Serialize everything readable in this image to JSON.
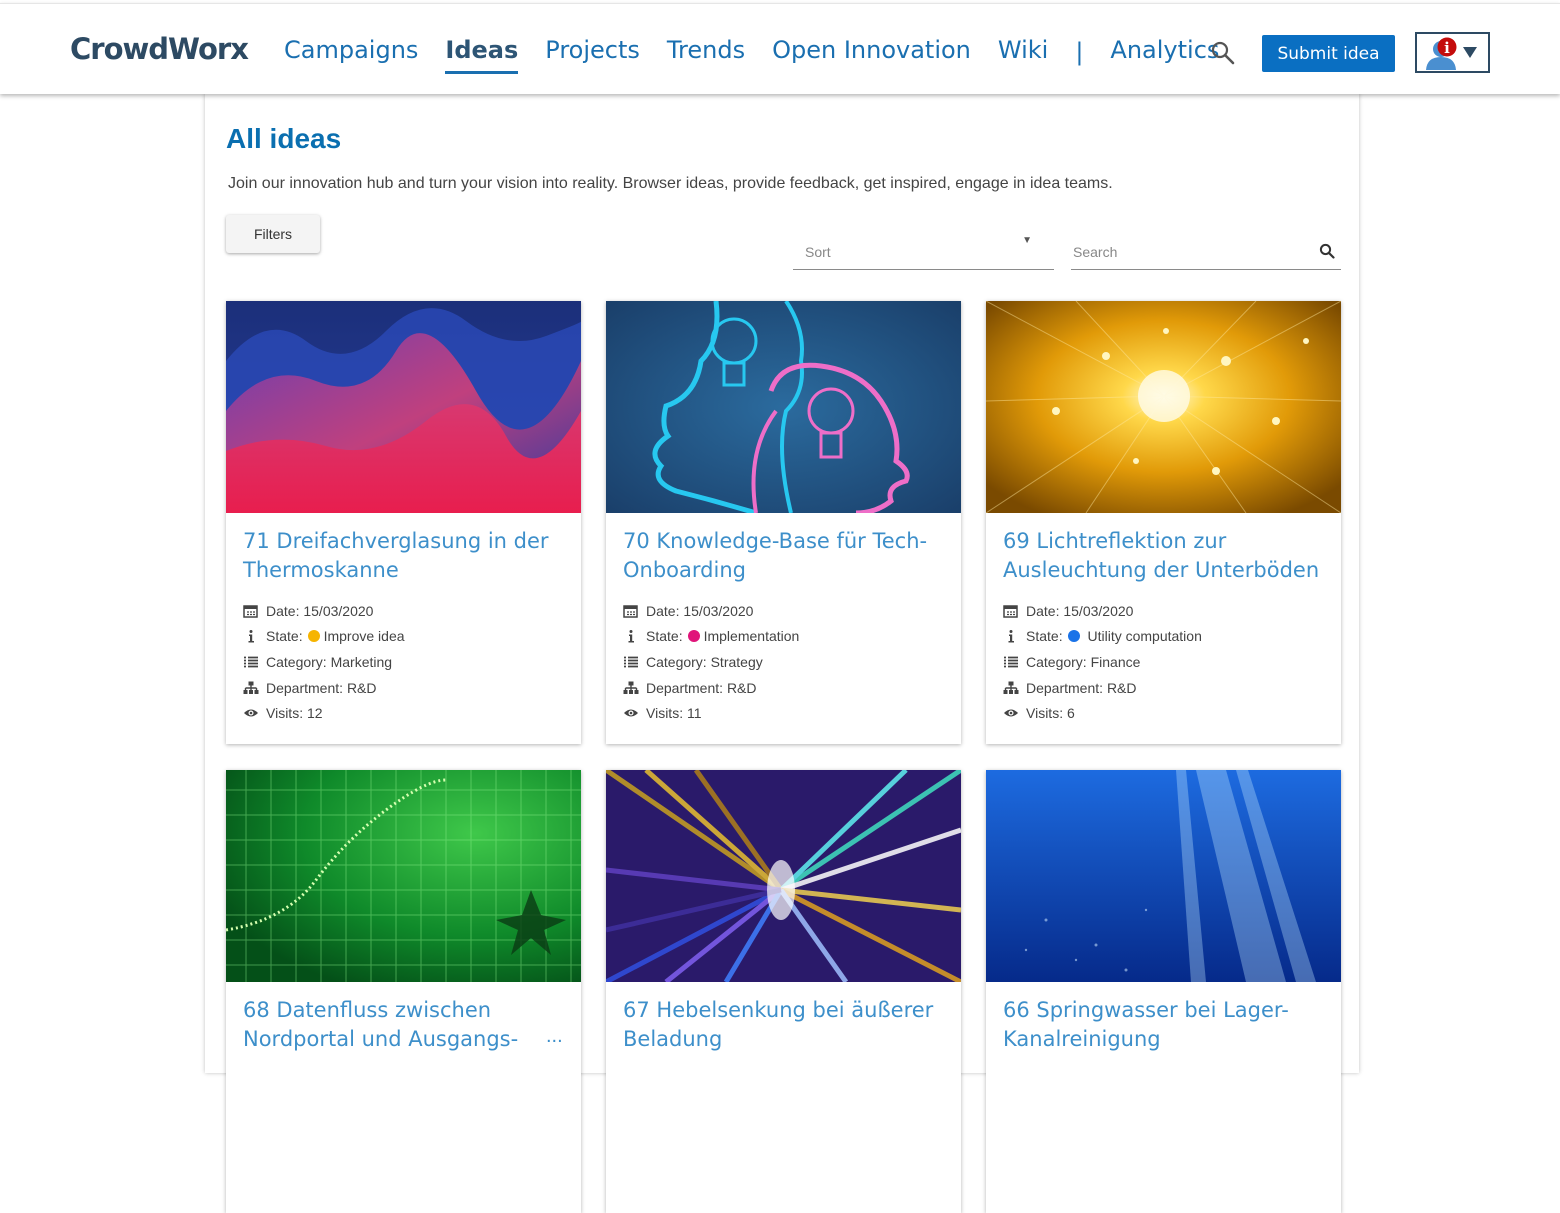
{
  "app": {
    "logo": "CrowdWorx"
  },
  "nav": {
    "items": [
      {
        "label": "Campaigns"
      },
      {
        "label": "Ideas",
        "active": true
      },
      {
        "label": "Projects"
      },
      {
        "label": "Trends"
      },
      {
        "label": "Open Innovation"
      },
      {
        "label": "Wiki"
      }
    ],
    "separator": "|",
    "analytics": "Analytics",
    "submit_label": "Submit idea",
    "user_badge": "i"
  },
  "page": {
    "title": "All ideas",
    "intro": "Join our innovation hub and turn your vision into reality. Browser ideas, provide feedback, get inspired, engage in idea teams.",
    "filters_label": "Filters",
    "sort_label": "Sort",
    "search_placeholder": "Search"
  },
  "colors": {
    "accent": "#0a6fc2",
    "title_blue": "#0a6fb0",
    "card_title": "#3d8fca",
    "state_improve": "#f6b400",
    "state_implementation": "#e0157a",
    "state_utility": "#1a73e8"
  },
  "labels": {
    "date": "Date:",
    "state": "State:",
    "category": "Category:",
    "department": "Department:",
    "visits": "Visits:"
  },
  "ideas": [
    {
      "title": "71 Dreifachverglasung in der Thermoskanne",
      "date": "15/03/2020",
      "state": "Improve idea",
      "state_color": "#f6b400",
      "category": "Marketing",
      "department": "R&D",
      "visits": "12",
      "image": "waves"
    },
    {
      "title": "70 Knowledge-Base für Tech-Onboarding",
      "date": "15/03/2020",
      "state": "Implementation",
      "state_color": "#e0157a",
      "category": "Strategy",
      "department": "R&D",
      "visits": "11",
      "image": "heads"
    },
    {
      "title": "69 Lichtreflektion zur Ausleuchtung der Unterböden",
      "date": "15/03/2020",
      "state": "Utility computation",
      "state_color": "#1a73e8",
      "category": "Finance",
      "department": "R&D",
      "visits": "6",
      "image": "golden-light"
    },
    {
      "title": "68 Datenfluss zwischen Nordportal und Ausgangs-",
      "title_ellipsis": "...",
      "image": "green-grid"
    },
    {
      "title": "67 Hebelsenkung bei äußerer Beladung",
      "image": "light-streaks"
    },
    {
      "title": "66 Springwasser bei Lager-Kanalreinigung",
      "image": "underwater"
    }
  ]
}
